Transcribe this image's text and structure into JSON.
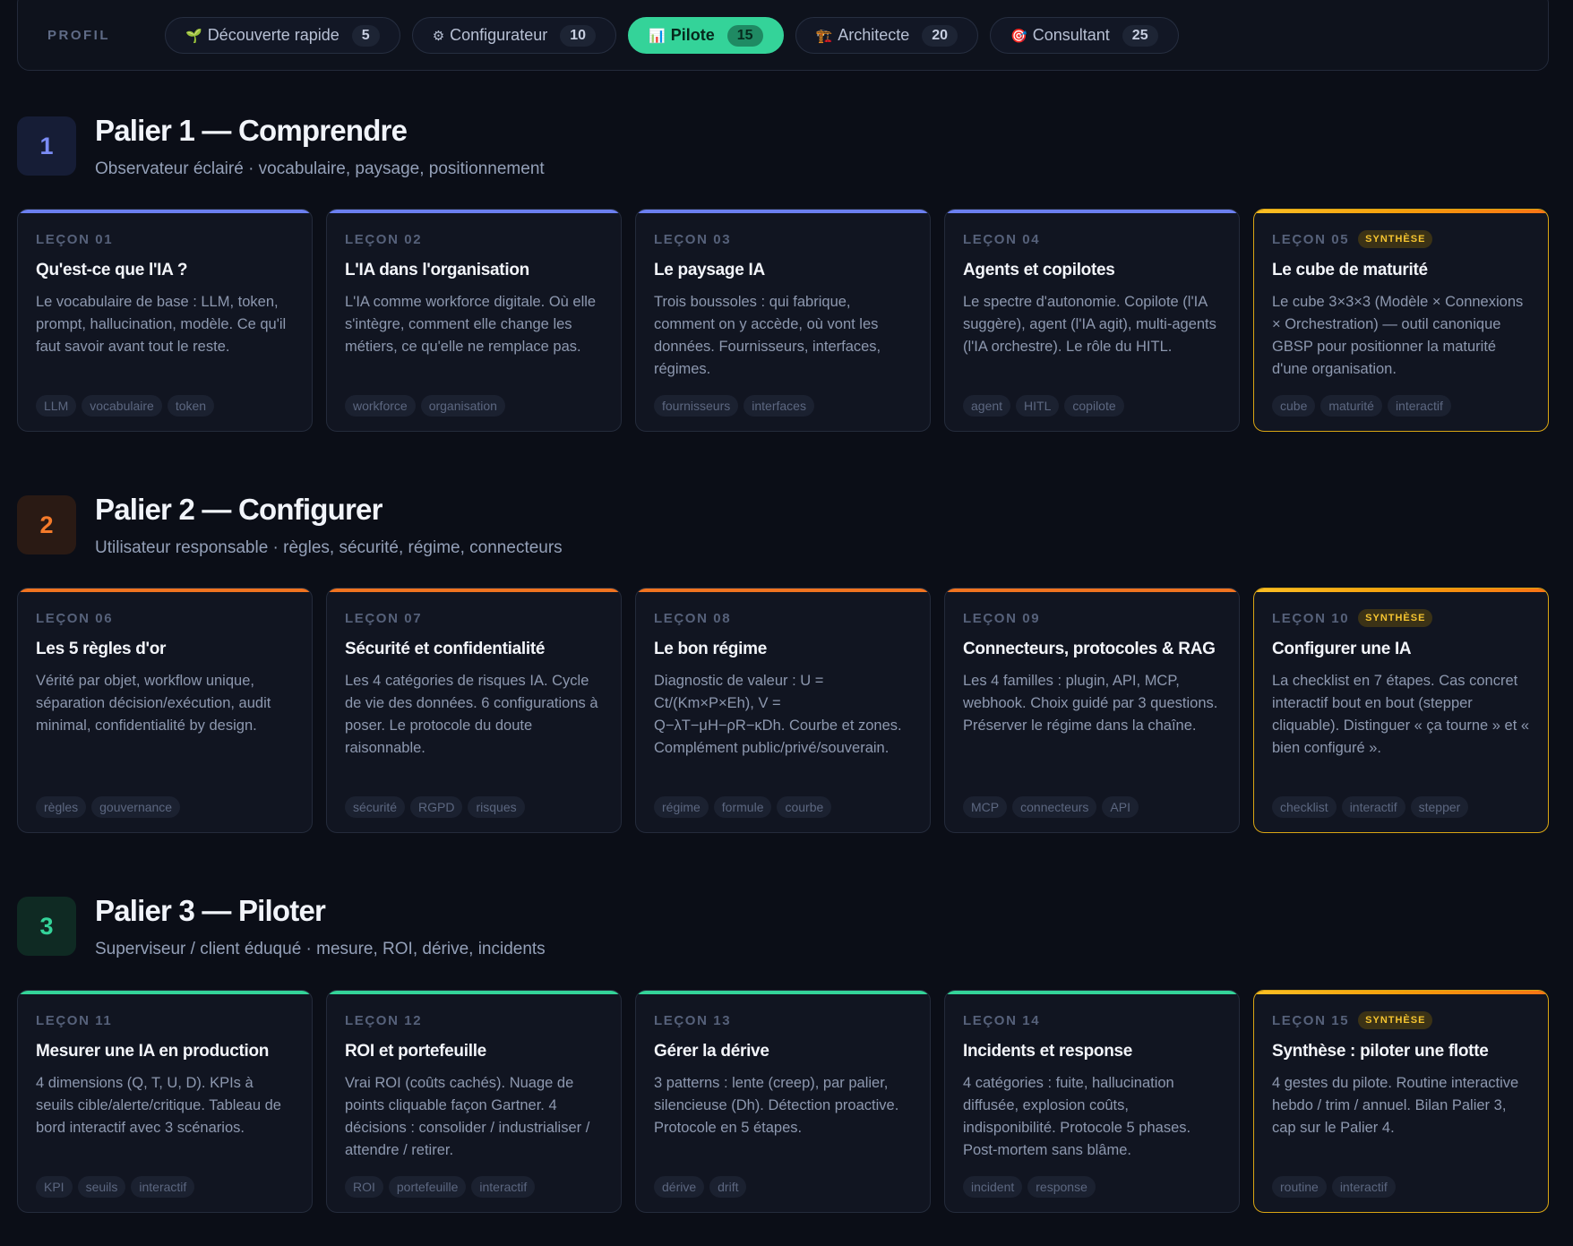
{
  "profile": {
    "label": "PROFIL",
    "tabs": [
      {
        "icon": "🌱",
        "label": "Découverte rapide",
        "count": "5"
      },
      {
        "icon": "⚙",
        "label": "Configurateur",
        "count": "10"
      },
      {
        "icon": "📊",
        "label": "Pilote",
        "count": "15",
        "active": true
      },
      {
        "icon": "🏗️",
        "label": "Architecte",
        "count": "20"
      },
      {
        "icon": "🎯",
        "label": "Consultant",
        "count": "25"
      }
    ]
  },
  "colors": {
    "tier1": "#6b7ff0",
    "tier2": "#f07320",
    "tier3": "#34d399",
    "synthesis": "#fbbf24",
    "active_pill": "#34d399"
  },
  "tiers": [
    {
      "number": "1",
      "title": "Palier 1 — Comprendre",
      "subtitle": "Observateur éclairé · vocabulaire, paysage, positionnement",
      "lessons": [
        {
          "num": "LEÇON 01",
          "title": "Qu'est-ce que l'IA ?",
          "desc": "Le vocabulaire de base : LLM, token, prompt, hallucination, modèle. Ce qu'il faut savoir avant tout le reste.",
          "tags": [
            "LLM",
            "vocabulaire",
            "token"
          ]
        },
        {
          "num": "LEÇON 02",
          "title": "L'IA dans l'organisation",
          "desc": "L'IA comme workforce digitale. Où elle s'intègre, comment elle change les métiers, ce qu'elle ne remplace pas.",
          "tags": [
            "workforce",
            "organisation"
          ]
        },
        {
          "num": "LEÇON 03",
          "title": "Le paysage IA",
          "desc": "Trois boussoles : qui fabrique, comment on y accède, où vont les données. Fournisseurs, interfaces, régimes.",
          "tags": [
            "fournisseurs",
            "interfaces"
          ]
        },
        {
          "num": "LEÇON 04",
          "title": "Agents et copilotes",
          "desc": "Le spectre d'autonomie. Copilote (l'IA suggère), agent (l'IA agit), multi-agents (l'IA orchestre). Le rôle du HITL.",
          "tags": [
            "agent",
            "HITL",
            "copilote"
          ]
        },
        {
          "num": "LEÇON 05",
          "synthesis": "SYNTHÈSE",
          "title": "Le cube de maturité",
          "desc": "Le cube 3×3×3 (Modèle × Connexions × Orchestration) — outil canonique GBSP pour positionner la maturité d'une organisation.",
          "tags": [
            "cube",
            "maturité",
            "interactif"
          ]
        }
      ]
    },
    {
      "number": "2",
      "title": "Palier 2 — Configurer",
      "subtitle": "Utilisateur responsable · règles, sécurité, régime, connecteurs",
      "lessons": [
        {
          "num": "LEÇON 06",
          "title": "Les 5 règles d'or",
          "desc": "Vérité par objet, workflow unique, séparation décision/exécution, audit minimal, confidentialité by design.",
          "tags": [
            "règles",
            "gouvernance"
          ]
        },
        {
          "num": "LEÇON 07",
          "title": "Sécurité et confidentialité",
          "desc": "Les 4 catégories de risques IA. Cycle de vie des données. 6 configurations à poser. Le protocole du doute raisonnable.",
          "tags": [
            "sécurité",
            "RGPD",
            "risques"
          ]
        },
        {
          "num": "LEÇON 08",
          "title": "Le bon régime",
          "desc": "Diagnostic de valeur : U = Ct/(Km×P×Eh), V = Q−λT−μH−ρR−κDh. Courbe et zones. Complément public/privé/souverain.",
          "tags": [
            "régime",
            "formule",
            "courbe"
          ]
        },
        {
          "num": "LEÇON 09",
          "title": "Connecteurs, protocoles & RAG",
          "desc": "Les 4 familles : plugin, API, MCP, webhook. Choix guidé par 3 questions. Préserver le régime dans la chaîne.",
          "tags": [
            "MCP",
            "connecteurs",
            "API"
          ]
        },
        {
          "num": "LEÇON 10",
          "synthesis": "SYNTHÈSE",
          "title": "Configurer une IA",
          "desc": "La checklist en 7 étapes. Cas concret interactif bout en bout (stepper cliquable). Distinguer « ça tourne » et « bien configuré ».",
          "tags": [
            "checklist",
            "interactif",
            "stepper"
          ]
        }
      ]
    },
    {
      "number": "3",
      "title": "Palier 3 — Piloter",
      "subtitle": "Superviseur / client éduqué · mesure, ROI, dérive, incidents",
      "lessons": [
        {
          "num": "LEÇON 11",
          "title": "Mesurer une IA en production",
          "desc": "4 dimensions (Q, T, U, D). KPIs à seuils cible/alerte/critique. Tableau de bord interactif avec 3 scénarios.",
          "tags": [
            "KPI",
            "seuils",
            "interactif"
          ]
        },
        {
          "num": "LEÇON 12",
          "title": "ROI et portefeuille",
          "desc": "Vrai ROI (coûts cachés). Nuage de points cliquable façon Gartner. 4 décisions : consolider / industrialiser / attendre / retirer.",
          "tags": [
            "ROI",
            "portefeuille",
            "interactif"
          ]
        },
        {
          "num": "LEÇON 13",
          "title": "Gérer la dérive",
          "desc": "3 patterns : lente (creep), par palier, silencieuse (Dh). Détection proactive. Protocole en 5 étapes.",
          "tags": [
            "dérive",
            "drift"
          ]
        },
        {
          "num": "LEÇON 14",
          "title": "Incidents et response",
          "desc": "4 catégories : fuite, hallucination diffusée, explosion coûts, indisponibilité. Protocole 5 phases. Post-mortem sans blâme.",
          "tags": [
            "incident",
            "response"
          ]
        },
        {
          "num": "LEÇON 15",
          "synthesis": "SYNTHÈSE",
          "title": "Synthèse : piloter une flotte",
          "desc": "4 gestes du pilote. Routine interactive hebdo / trim / annuel. Bilan Palier 3, cap sur le Palier 4.",
          "tags": [
            "routine",
            "interactif"
          ]
        }
      ]
    }
  ]
}
